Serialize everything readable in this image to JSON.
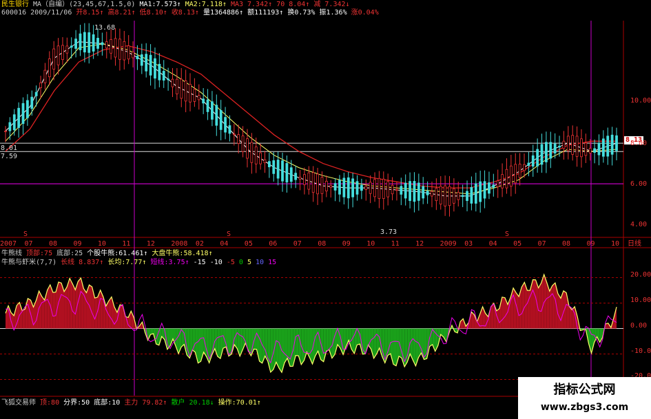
{
  "header": {
    "stock_name": "民生银行",
    "ma_label": "MA（自编）(23,45,67,1.5,0)",
    "ma1": "MA1:7.573↑",
    "ma2": "MA2:7.118↑",
    "ma3": "MA3 7.342↑",
    "ma4": "70 8.04↑",
    "ma5": "减 7.342↓",
    "code_date": "600016 2009/11/06",
    "open": "开8.15↑",
    "high": "高8.21↑",
    "low": "低8.10↑",
    "close": "收8.13↑",
    "volume": "量1364886↑",
    "amount": "额111193↑",
    "turnover": "换0.73%",
    "amplitude": "振1.36%",
    "change": "涨0.04%"
  },
  "price_labels": {
    "high_peak": "13.68",
    "low_trough": "3.73",
    "left_a": "8.01",
    "left_b": "7.59",
    "current": "8.13"
  },
  "price_axis": [
    "10.00",
    "8.00",
    "6.00",
    "4.00"
  ],
  "x_axis": [
    "2007",
    "07",
    "08",
    "09",
    "10",
    "11",
    "12",
    "2008",
    "02",
    "04",
    "05",
    "06",
    "07",
    "08",
    "09",
    "10",
    "11",
    "12",
    "2009",
    "03",
    "04",
    "05",
    "07",
    "08",
    "09",
    "10"
  ],
  "period_label": "日线",
  "marker_s": "S",
  "ind1": {
    "name": "牛熊线",
    "top": "顶部:75",
    "bottom": "底部:25",
    "stock": "个股牛熊:61.461↑",
    "market": "大盘牛熊:58.418↑"
  },
  "ind2": {
    "name": "牛熊与虾米(7,7)",
    "long": "长线 8.837↑",
    "long_avg": "长均:7.77↑",
    "short": "短线:3.75↑",
    "v1": "-15",
    "v2": "-10",
    "v3": "-5",
    "v4": "0",
    "v5": "5",
    "v6": "10",
    "v7": "15"
  },
  "ind_axis": [
    "20.00",
    "10.00",
    "0.00",
    "-10.00",
    "-20.00"
  ],
  "footer": {
    "name": "飞狐交易师",
    "top": "顶:80",
    "divide": "分界:50",
    "bottom": "底部:10",
    "main": "主力 79.82↑",
    "retail": "散户 20.18↓",
    "operate": "操作:70.01↑"
  },
  "watermark": {
    "title": "指标公式网",
    "url": "www.zbgs3.com"
  },
  "chart_data": [
    {
      "type": "line",
      "title": "",
      "x": [
        "2007",
        "07",
        "08",
        "09",
        "10",
        "11",
        "12",
        "2008",
        "02",
        "04",
        "05",
        "06",
        "07",
        "08",
        "09",
        "10",
        "11",
        "12",
        "2009",
        "03",
        "04",
        "05",
        "07",
        "08",
        "09",
        "10"
      ],
      "series": [
        {
          "name": "MA1",
          "values": [
            8.6,
            9.8,
            12.2,
            13.0,
            12.9,
            12.5,
            11.8,
            10.8,
            10.2,
            8.9,
            7.6,
            6.8,
            6.3,
            5.9,
            5.8,
            5.8,
            5.7,
            5.6,
            5.4,
            5.4,
            5.9,
            6.6,
            7.5,
            8.0,
            7.6,
            8.0
          ]
        },
        {
          "name": "MA2",
          "values": [
            8.1,
            9.4,
            11.3,
            12.7,
            12.9,
            12.6,
            12.0,
            11.3,
            10.5,
            9.4,
            8.3,
            7.4,
            6.8,
            6.4,
            6.1,
            5.9,
            5.8,
            5.7,
            5.6,
            5.5,
            5.8,
            6.2,
            7.1,
            7.7,
            7.6,
            7.7
          ]
        },
        {
          "name": "MA3",
          "values": [
            7.6,
            8.7,
            10.6,
            12.0,
            12.6,
            12.8,
            12.5,
            12.0,
            11.4,
            10.4,
            9.4,
            8.4,
            7.6,
            7.0,
            6.6,
            6.3,
            6.1,
            5.9,
            5.8,
            5.8,
            6.1,
            6.5,
            7.3,
            7.9,
            8.1,
            8.1
          ]
        }
      ],
      "price_range": [
        3.7,
        13.7
      ],
      "horizontal_levels": [
        8.0,
        7.59,
        6.0
      ]
    },
    {
      "type": "area",
      "title": "",
      "x": [
        "2007",
        "07",
        "08",
        "09",
        "10",
        "11",
        "12",
        "2008",
        "02",
        "04",
        "05",
        "06",
        "07",
        "08",
        "09",
        "10",
        "11",
        "12",
        "2009",
        "03",
        "04",
        "05",
        "07",
        "08",
        "09",
        "10"
      ],
      "series": [
        {
          "name": "长线",
          "values": [
            6,
            10,
            16,
            18,
            12,
            6,
            -4,
            -7,
            -12,
            -9,
            -8,
            -16,
            -12,
            -11,
            -7,
            -9,
            -13,
            -12,
            -3,
            4,
            8,
            15,
            19,
            12,
            -8,
            6
          ]
        }
      ],
      "ylim": [
        -25,
        25
      ],
      "reference_lines": [
        20,
        10,
        0,
        -10,
        -20
      ]
    }
  ]
}
